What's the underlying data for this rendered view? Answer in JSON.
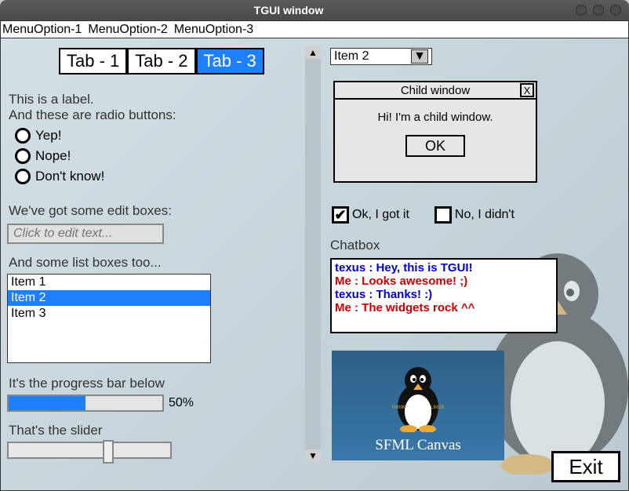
{
  "window": {
    "title": "TGUI window"
  },
  "menubar": {
    "items": [
      "MenuOption-1",
      "MenuOption-2",
      "MenuOption-3"
    ]
  },
  "tabs": {
    "items": [
      "Tab - 1",
      "Tab - 2",
      "Tab - 3"
    ],
    "selected_index": 2
  },
  "labels": {
    "intro1": "This is a label.",
    "intro2": "And these are radio buttons:",
    "editboxes": "We've got some edit boxes:",
    "listboxes": "And some list boxes too...",
    "progress": "It's the progress bar below",
    "slider": "That's the slider",
    "chatbox": "Chatbox"
  },
  "radios": {
    "items": [
      "Yep!",
      "Nope!",
      "Don't know!"
    ],
    "selected_index": -1
  },
  "editbox": {
    "placeholder": "Click to edit text...",
    "value": ""
  },
  "listbox": {
    "items": [
      "Item 1",
      "Item 2",
      "Item 3"
    ],
    "selected_index": 1
  },
  "progress": {
    "value_percent": 50,
    "label": "50%"
  },
  "slider": {
    "value_percent": 58
  },
  "combo": {
    "selected": "Item 2"
  },
  "child_window": {
    "title": "Child window",
    "message": "Hi! I'm a child window.",
    "ok_label": "OK",
    "close_label": "X"
  },
  "checkboxes": {
    "items": [
      {
        "label": "Ok, I got it",
        "checked": true
      },
      {
        "label": "No, I didn't",
        "checked": false
      }
    ]
  },
  "chat": {
    "lines": [
      {
        "text": "texus : Hey, this is TGUI!",
        "color": "blue"
      },
      {
        "text": "Me : Looks awesome! ;)",
        "color": "red"
      },
      {
        "text": "texus : Thanks! :)",
        "color": "blue"
      },
      {
        "text": "Me : The widgets rock ^^",
        "color": "red"
      }
    ]
  },
  "canvas": {
    "label": "SFML Canvas",
    "side_text_left": "THINK",
    "side_text_right": "LINUX"
  },
  "exit": {
    "label": "Exit"
  }
}
